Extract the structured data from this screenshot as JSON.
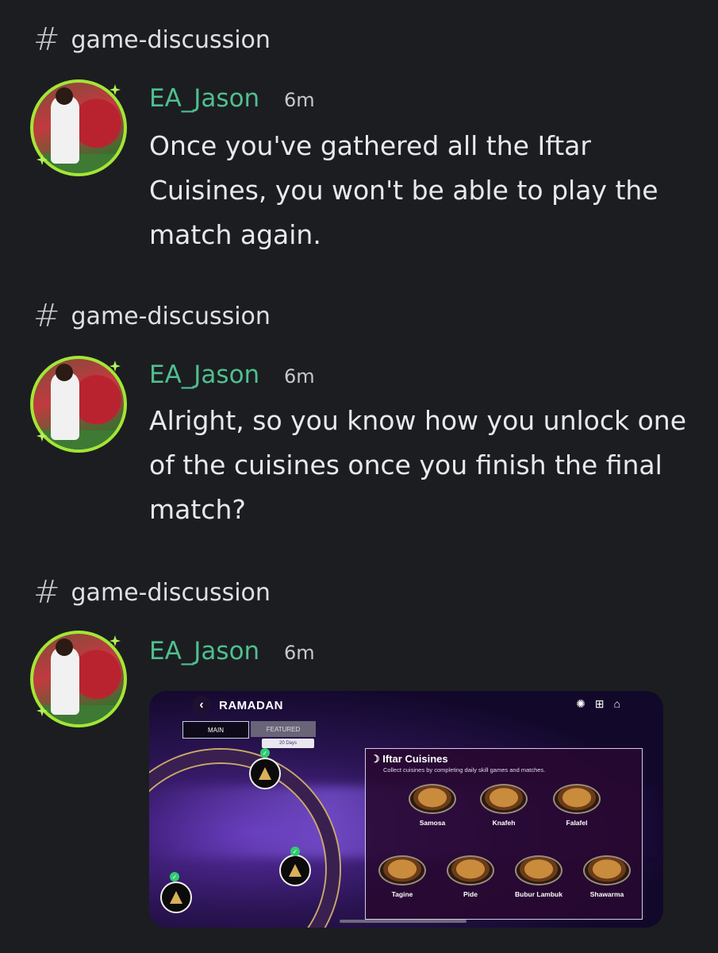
{
  "messages": [
    {
      "channel": "game-discussion",
      "username": "EA_Jason",
      "time": "6m",
      "text": "Once you've gathered all the Iftar Cuisines, you won't be able to play the match again."
    },
    {
      "channel": "game-discussion",
      "username": "EA_Jason",
      "time": "6m",
      "text": "Alright, so you know how you unlock one of the cuisines once you finish the final match?"
    },
    {
      "channel": "game-discussion",
      "username": "EA_Jason",
      "time": "6m",
      "text": ""
    }
  ],
  "attachment": {
    "screen_title": "RAMADAN",
    "tabs": [
      "MAIN",
      "FEATURED"
    ],
    "days_badge": "20 Days",
    "panel_title": "Iftar Cuisines",
    "panel_subtitle": "Collect cuisines by completing daily skill games and matches.",
    "cuisines": [
      "Samosa",
      "Knafeh",
      "Falafel",
      "Tagine",
      "Pide",
      "Bubur Lambuk",
      "Shawarma"
    ]
  },
  "icons": {
    "channel": "hash-icon",
    "back": "chevron-left-icon",
    "store": "cart-icon",
    "home": "home-icon"
  },
  "colors": {
    "background": "#1c1d21",
    "username": "#4fbf8f",
    "avatar_ring": "#a3e635"
  }
}
